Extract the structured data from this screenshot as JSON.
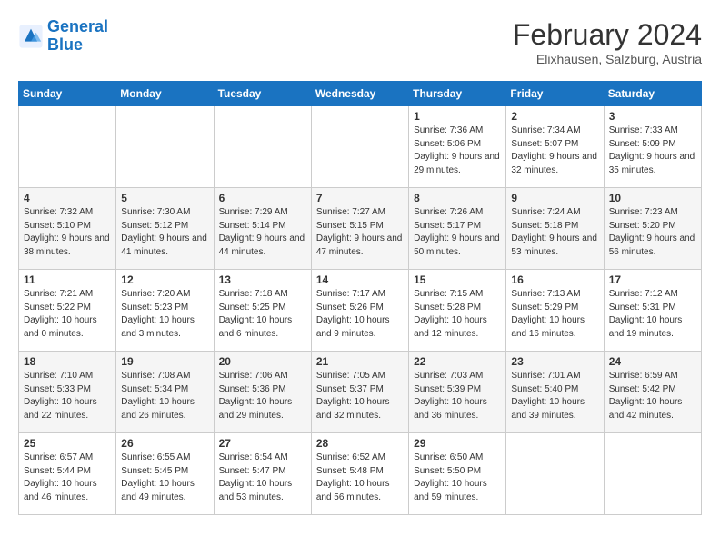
{
  "logo": {
    "line1": "General",
    "line2": "Blue"
  },
  "title": "February 2024",
  "subtitle": "Elixhausen, Salzburg, Austria",
  "weekdays": [
    "Sunday",
    "Monday",
    "Tuesday",
    "Wednesday",
    "Thursday",
    "Friday",
    "Saturday"
  ],
  "weeks": [
    [
      {
        "day": "",
        "sunrise": "",
        "sunset": "",
        "daylight": ""
      },
      {
        "day": "",
        "sunrise": "",
        "sunset": "",
        "daylight": ""
      },
      {
        "day": "",
        "sunrise": "",
        "sunset": "",
        "daylight": ""
      },
      {
        "day": "",
        "sunrise": "",
        "sunset": "",
        "daylight": ""
      },
      {
        "day": "1",
        "sunrise": "Sunrise: 7:36 AM",
        "sunset": "Sunset: 5:06 PM",
        "daylight": "Daylight: 9 hours and 29 minutes."
      },
      {
        "day": "2",
        "sunrise": "Sunrise: 7:34 AM",
        "sunset": "Sunset: 5:07 PM",
        "daylight": "Daylight: 9 hours and 32 minutes."
      },
      {
        "day": "3",
        "sunrise": "Sunrise: 7:33 AM",
        "sunset": "Sunset: 5:09 PM",
        "daylight": "Daylight: 9 hours and 35 minutes."
      }
    ],
    [
      {
        "day": "4",
        "sunrise": "Sunrise: 7:32 AM",
        "sunset": "Sunset: 5:10 PM",
        "daylight": "Daylight: 9 hours and 38 minutes."
      },
      {
        "day": "5",
        "sunrise": "Sunrise: 7:30 AM",
        "sunset": "Sunset: 5:12 PM",
        "daylight": "Daylight: 9 hours and 41 minutes."
      },
      {
        "day": "6",
        "sunrise": "Sunrise: 7:29 AM",
        "sunset": "Sunset: 5:14 PM",
        "daylight": "Daylight: 9 hours and 44 minutes."
      },
      {
        "day": "7",
        "sunrise": "Sunrise: 7:27 AM",
        "sunset": "Sunset: 5:15 PM",
        "daylight": "Daylight: 9 hours and 47 minutes."
      },
      {
        "day": "8",
        "sunrise": "Sunrise: 7:26 AM",
        "sunset": "Sunset: 5:17 PM",
        "daylight": "Daylight: 9 hours and 50 minutes."
      },
      {
        "day": "9",
        "sunrise": "Sunrise: 7:24 AM",
        "sunset": "Sunset: 5:18 PM",
        "daylight": "Daylight: 9 hours and 53 minutes."
      },
      {
        "day": "10",
        "sunrise": "Sunrise: 7:23 AM",
        "sunset": "Sunset: 5:20 PM",
        "daylight": "Daylight: 9 hours and 56 minutes."
      }
    ],
    [
      {
        "day": "11",
        "sunrise": "Sunrise: 7:21 AM",
        "sunset": "Sunset: 5:22 PM",
        "daylight": "Daylight: 10 hours and 0 minutes."
      },
      {
        "day": "12",
        "sunrise": "Sunrise: 7:20 AM",
        "sunset": "Sunset: 5:23 PM",
        "daylight": "Daylight: 10 hours and 3 minutes."
      },
      {
        "day": "13",
        "sunrise": "Sunrise: 7:18 AM",
        "sunset": "Sunset: 5:25 PM",
        "daylight": "Daylight: 10 hours and 6 minutes."
      },
      {
        "day": "14",
        "sunrise": "Sunrise: 7:17 AM",
        "sunset": "Sunset: 5:26 PM",
        "daylight": "Daylight: 10 hours and 9 minutes."
      },
      {
        "day": "15",
        "sunrise": "Sunrise: 7:15 AM",
        "sunset": "Sunset: 5:28 PM",
        "daylight": "Daylight: 10 hours and 12 minutes."
      },
      {
        "day": "16",
        "sunrise": "Sunrise: 7:13 AM",
        "sunset": "Sunset: 5:29 PM",
        "daylight": "Daylight: 10 hours and 16 minutes."
      },
      {
        "day": "17",
        "sunrise": "Sunrise: 7:12 AM",
        "sunset": "Sunset: 5:31 PM",
        "daylight": "Daylight: 10 hours and 19 minutes."
      }
    ],
    [
      {
        "day": "18",
        "sunrise": "Sunrise: 7:10 AM",
        "sunset": "Sunset: 5:33 PM",
        "daylight": "Daylight: 10 hours and 22 minutes."
      },
      {
        "day": "19",
        "sunrise": "Sunrise: 7:08 AM",
        "sunset": "Sunset: 5:34 PM",
        "daylight": "Daylight: 10 hours and 26 minutes."
      },
      {
        "day": "20",
        "sunrise": "Sunrise: 7:06 AM",
        "sunset": "Sunset: 5:36 PM",
        "daylight": "Daylight: 10 hours and 29 minutes."
      },
      {
        "day": "21",
        "sunrise": "Sunrise: 7:05 AM",
        "sunset": "Sunset: 5:37 PM",
        "daylight": "Daylight: 10 hours and 32 minutes."
      },
      {
        "day": "22",
        "sunrise": "Sunrise: 7:03 AM",
        "sunset": "Sunset: 5:39 PM",
        "daylight": "Daylight: 10 hours and 36 minutes."
      },
      {
        "day": "23",
        "sunrise": "Sunrise: 7:01 AM",
        "sunset": "Sunset: 5:40 PM",
        "daylight": "Daylight: 10 hours and 39 minutes."
      },
      {
        "day": "24",
        "sunrise": "Sunrise: 6:59 AM",
        "sunset": "Sunset: 5:42 PM",
        "daylight": "Daylight: 10 hours and 42 minutes."
      }
    ],
    [
      {
        "day": "25",
        "sunrise": "Sunrise: 6:57 AM",
        "sunset": "Sunset: 5:44 PM",
        "daylight": "Daylight: 10 hours and 46 minutes."
      },
      {
        "day": "26",
        "sunrise": "Sunrise: 6:55 AM",
        "sunset": "Sunset: 5:45 PM",
        "daylight": "Daylight: 10 hours and 49 minutes."
      },
      {
        "day": "27",
        "sunrise": "Sunrise: 6:54 AM",
        "sunset": "Sunset: 5:47 PM",
        "daylight": "Daylight: 10 hours and 53 minutes."
      },
      {
        "day": "28",
        "sunrise": "Sunrise: 6:52 AM",
        "sunset": "Sunset: 5:48 PM",
        "daylight": "Daylight: 10 hours and 56 minutes."
      },
      {
        "day": "29",
        "sunrise": "Sunrise: 6:50 AM",
        "sunset": "Sunset: 5:50 PM",
        "daylight": "Daylight: 10 hours and 59 minutes."
      },
      {
        "day": "",
        "sunrise": "",
        "sunset": "",
        "daylight": ""
      },
      {
        "day": "",
        "sunrise": "",
        "sunset": "",
        "daylight": ""
      }
    ]
  ]
}
